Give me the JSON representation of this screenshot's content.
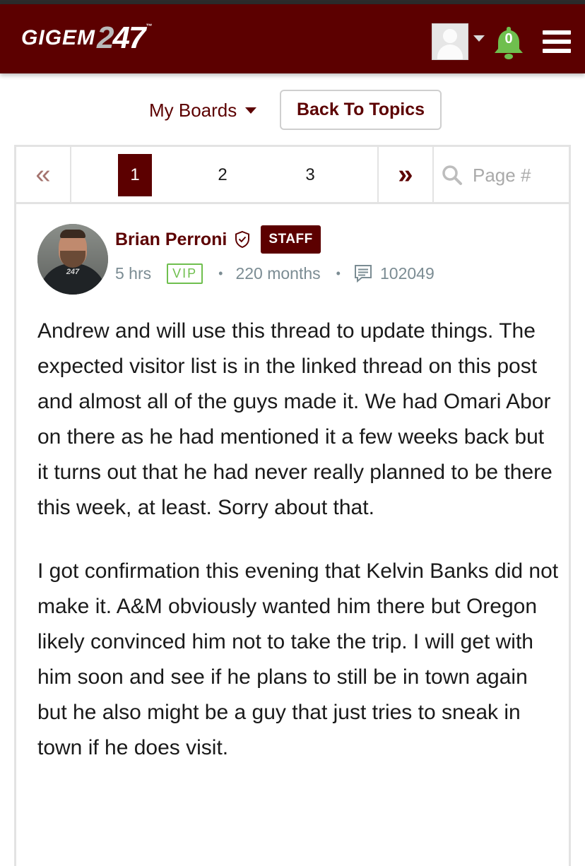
{
  "header": {
    "logo": {
      "part1": "GIGEM",
      "part2": "2",
      "part3": "47",
      "tm": "™"
    },
    "notifications_count": "0",
    "icons": {
      "avatar": "user-avatar-placeholder-icon",
      "dropdown": "caret-down-icon",
      "bell": "bell-icon",
      "menu": "hamburger-menu-icon"
    },
    "brand_color": "#5c0000",
    "bell_color": "#6fbf4e"
  },
  "boards": {
    "my_boards_label": "My Boards",
    "back_to_topics_label": "Back To Topics"
  },
  "pagination": {
    "first_icon": "«",
    "last_icon": "»",
    "pages": [
      "1",
      "2",
      "3"
    ],
    "current_page": "1",
    "search_placeholder": "Page #"
  },
  "post": {
    "author": "Brian Perroni",
    "badge": "STAFF",
    "time": "5 hrs",
    "vip": "VIP",
    "tenure": "220 months",
    "post_count": "102049",
    "avatar_text": "247",
    "paragraphs": [
      "Andrew and will use this thread to update things. The expected visitor list is in the linked thread on this post and almost all of the guys made it. We had Omari Abor on there as he had mentioned it a few weeks back but it turns out that he had never really planned to be there this week, at least. Sorry about that.",
      "I got confirmation this evening that Kelvin Banks did not make it. A&M obviously wanted him there but Oregon likely convinced him not to take the trip. I will get with him soon and see if he plans to still be in town again but he also might be a guy that just tries to sneak in town if he does visit."
    ]
  }
}
